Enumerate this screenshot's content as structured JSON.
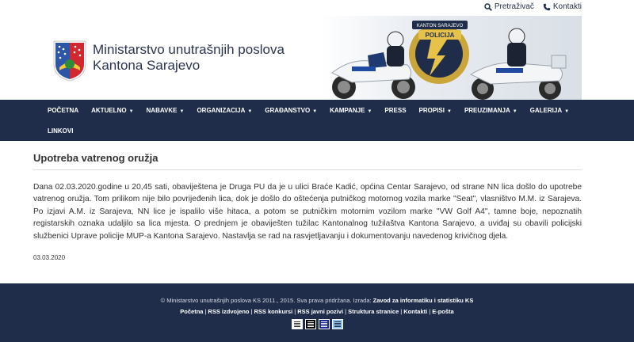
{
  "toplinks": {
    "search_label": "Pretraživač",
    "contact_label": "Kontakti"
  },
  "header": {
    "org_line1": "Ministarstvo unutrašnjih poslova",
    "org_line2": "Kantona Sarajevo",
    "badge_text": "KANTON SARAJEVO",
    "badge_word": "POLICIJA"
  },
  "nav": {
    "row1": [
      {
        "label": "POČETNA",
        "dropdown": false
      },
      {
        "label": "AKTUELNO",
        "dropdown": true
      },
      {
        "label": "NABAVKE",
        "dropdown": true
      },
      {
        "label": "ORGANIZACIJA",
        "dropdown": true
      },
      {
        "label": "GRAĐANSTVO",
        "dropdown": true
      },
      {
        "label": "KAMPANJE",
        "dropdown": true
      },
      {
        "label": "PRESS",
        "dropdown": false
      },
      {
        "label": "PROPISI",
        "dropdown": true
      },
      {
        "label": "PREUZIMANJA",
        "dropdown": true
      },
      {
        "label": "GALERIJA",
        "dropdown": true
      }
    ],
    "row2": [
      {
        "label": "LINKOVI",
        "dropdown": false
      }
    ],
    "caret": "▼"
  },
  "main": {
    "title": "Upotreba vatrenog oružja",
    "body": "Dana 02.03.2020.godine u 20,45 sati, obaviještena je Druga PU da je u ulici Braće Kadić, općina Centar Sarajevo, od strane NN lica došlo do upotrebe vatrenog oružja. Tom prilikom nije bilo povrijeđenih lica, dok je došlo do oštećenja putničkog motornog vozila marke \"Seat\", vlasništvo M.M. iz Sarajeva. Po izjavi A.M. iz Sarajeva, NN lice je ispalilo više hitaca, a potom se putničkim motornim vozilom marke \"VW Golf A4\", tamne boje, nepoznatih registarskih oznaka udaljilo sa lica mjesta. O prednjem je obaviješten tužilac Kantonalnog tužilaštva Kantona Sarajevo, a uviđaj su obavili policijski službenici Uprave policije MUP-a Kantona Sarajevo. Nastavlja se rad na rasvjetljavanju i dokumentovanju navedenog krivičnog djela.",
    "date": "03.03.2020"
  },
  "footer": {
    "copyright": "© Ministarstvo unutrašnjih poslova KS 2011., 2015. Sva prava pridržana. Izrada: ",
    "maker": "Zavod za informatiku i statistiku KS",
    "links": [
      "Početna",
      "RSS izdvojeno",
      "RSS konkursi",
      "RSS javni pozivi",
      "Struktura stranice",
      "Kontakti",
      "E-pošta"
    ],
    "link_separator": "|",
    "themes": [
      {
        "name": "theme-white",
        "bg": "#ffffff",
        "line": "#333333"
      },
      {
        "name": "theme-black",
        "bg": "#000000",
        "line": "#ffffff"
      },
      {
        "name": "theme-blue",
        "bg": "#1a2a9a",
        "line": "#ffffff"
      },
      {
        "name": "theme-lightblue",
        "bg": "#8fc6ea",
        "line": "#1f2d4a"
      }
    ]
  },
  "colors": {
    "navy": "#1f2d4a",
    "text": "#333333"
  }
}
